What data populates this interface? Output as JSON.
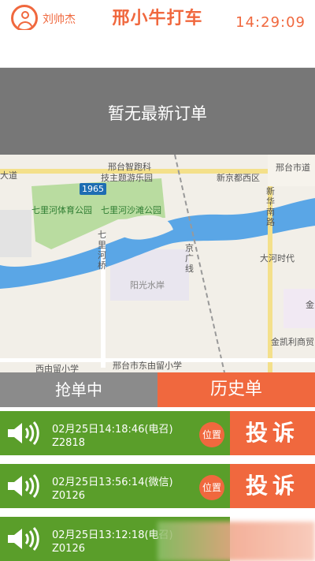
{
  "header": {
    "user_name": "刘帅杰",
    "app_title": "邢小牛打车",
    "clock": "14:29:09"
  },
  "notice": {
    "text": "暂无最新订单"
  },
  "map": {
    "labels": {
      "park_1": "邢台智跑科",
      "park_2": "技主题游乐园",
      "park_3": "七里河体育公园",
      "park_4": "七里河沙滩公园",
      "badge": "1965",
      "district": "新京都西区",
      "road_1": "邢台市道",
      "road_2": "新华南路",
      "road_3": "大河时代",
      "road_4": "京广线",
      "bridge": "七里河桥",
      "estate": "阳光水岸",
      "school_1": "西由留小学",
      "school_2": "邢台市东由留小学",
      "shop": "金凯利商贸",
      "partial": "金",
      "left_edge": "大道"
    }
  },
  "tabs": {
    "left": "抢单中",
    "right": "历史单"
  },
  "orders": [
    {
      "time": "02月25日14:18:46(电召)",
      "code": "Z2818",
      "location": "位置",
      "action": "投诉"
    },
    {
      "time": "02月25日13:56:14(微信)",
      "code": "Z0126",
      "location": "位置",
      "action": "投诉"
    },
    {
      "time": "02月25日13:12:18(电召)",
      "code": "Z0126",
      "location": "",
      "action": ""
    }
  ],
  "colors": {
    "accent": "#f0683e",
    "order_green": "#5a9e2a",
    "notice_gray": "#777777",
    "tab_gray": "#8b8b8b"
  }
}
